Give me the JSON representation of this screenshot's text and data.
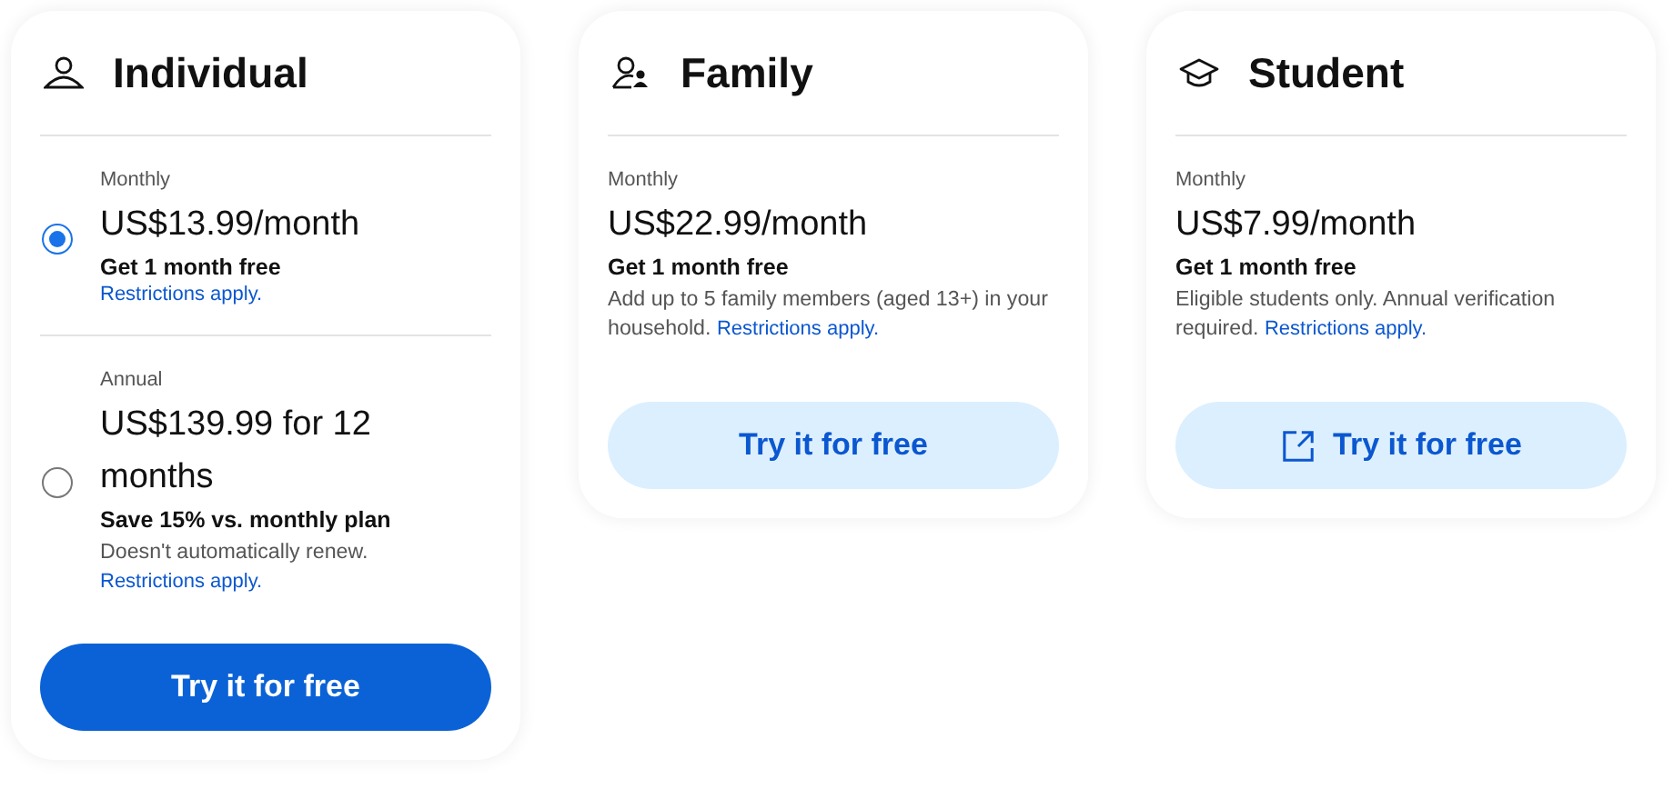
{
  "cards": [
    {
      "kind": "person",
      "title": "Individual",
      "plans": [
        {
          "kind": "radio",
          "selected": true,
          "period": "Monthly",
          "price": "US$13.99/month",
          "offer": "Get 1 month free",
          "link": "Restrictions apply."
        },
        {
          "kind": "radio",
          "selected": false,
          "period": "Annual",
          "price": "US$139.99 for 12 months",
          "offer": "Save 15% vs. monthly plan",
          "note": "Doesn't automatically renew.",
          "link": "Restrictions apply."
        }
      ],
      "button": {
        "label": "Try it for free",
        "primary": true,
        "external": false
      }
    },
    {
      "kind": "family",
      "title": "Family",
      "plans": [
        {
          "kind": "plain",
          "period": "Monthly",
          "price": "US$22.99/month",
          "offer": "Get 1 month free",
          "note": "Add up to 5 family members (aged 13+) in your household.",
          "link": "Restrictions apply."
        }
      ],
      "button": {
        "label": "Try it for free",
        "primary": false,
        "external": false
      }
    },
    {
      "kind": "student",
      "title": "Student",
      "plans": [
        {
          "kind": "plain",
          "period": "Monthly",
          "price": "US$7.99/month",
          "offer": "Get 1 month free",
          "note": "Eligible students only. Annual verification required.",
          "link": "Restrictions apply."
        }
      ],
      "button": {
        "label": "Try it for free",
        "primary": false,
        "external": true
      }
    }
  ]
}
